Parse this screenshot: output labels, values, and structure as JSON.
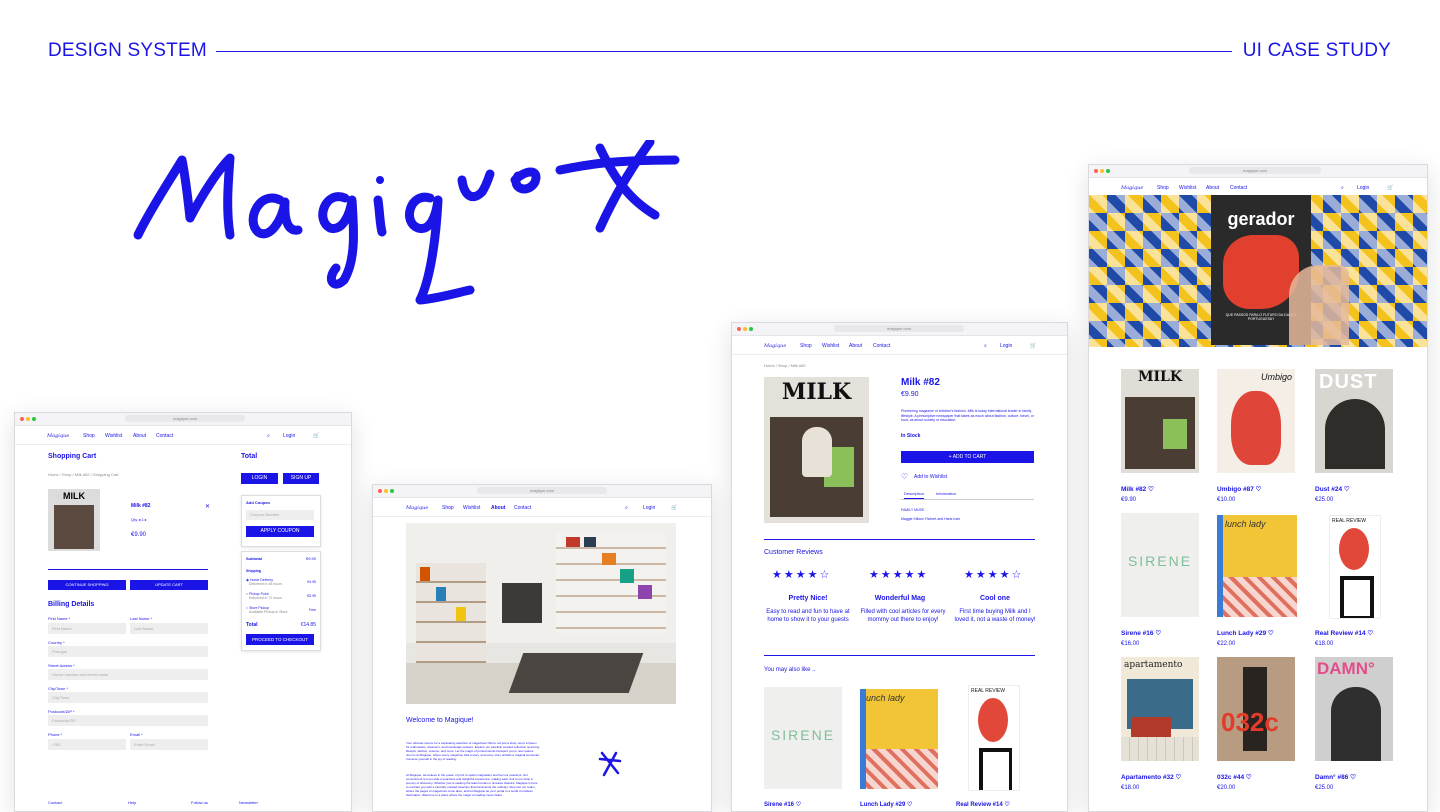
{
  "header": {
    "left": "DESIGN SYSTEM",
    "right": "UI CASE STUDY"
  },
  "brand": {
    "logo_text": "Magique"
  },
  "colors": {
    "accent": "#1a14e6"
  },
  "browser": {
    "url": "magique.com"
  },
  "nav": {
    "shop": "Shop",
    "wishlist": "Wishlist",
    "about": "About",
    "contact": "Contact",
    "login": "Login"
  },
  "cart": {
    "title": "Shopping Cart",
    "breadcrumb": "Home / Shop / Milk #82 / Shopping Cart",
    "item_title": "Milk #82",
    "qty": "Qty ◂ 1 ▸",
    "price": "€9.90",
    "remove": "✕",
    "continue": "CONTINUE SHOPPING",
    "update": "UPDATE CART",
    "total_title": "Total",
    "login_btn": "LOGIN",
    "signup_btn": "SIGN UP",
    "coupon_label": "Add Coupon",
    "coupon_placeholder": "Coupon Number",
    "apply": "APPLY COUPON",
    "subtotal_label": "Subtotal",
    "subtotal_value": "€9.90",
    "shipping_label": "Shipping",
    "ship_options": [
      {
        "name": "Home Delivery",
        "note": "Delivered in 48 hours",
        "price": "€4.95"
      },
      {
        "name": "Pickup Point",
        "note": "Delivered in 72 hours",
        "price": "€3.95"
      },
      {
        "name": "Store Pickup",
        "note": "Available Pickup in Store",
        "price": "Free"
      }
    ],
    "total_label": "Total",
    "total_value": "€14.85",
    "checkout": "PROCEED TO CHECKOUT",
    "billing_title": "Billing Details",
    "billing": {
      "first_label": "First Name *",
      "first_ph": "First Name",
      "last_label": "Last Name *",
      "last_ph": "Last Name",
      "country_label": "Country *",
      "country_val": "Portugal",
      "street_label": "Street Adress *",
      "street_ph": "House number and street name",
      "city_label": "City/Town *",
      "city_ph": "City/Town",
      "postcode_label": "Postcode/ZIP *",
      "postcode_ph": "Postcode/ZIP",
      "phone_label": "Phone *",
      "phone_ph": "+351",
      "email_label": "Email *",
      "email_ph": "Enter Email"
    },
    "footer": {
      "contact": "Contact",
      "help": "Help",
      "follow": "Follow us",
      "newsletter": "Newsletter"
    }
  },
  "about": {
    "welcome": "Welcome to Magique!",
    "para1": "Your ultimate source for a captivating selection of magazines! We're not just a shop; we're a haven for enthusiasts, dreamers, and knowledge seekers. Explore our carefully curated collection spanning lifestyle, fashion, science, and more. Let the magic of printed words transport you to new realms. Join us at Magique, where every magazine tells a story, and every story unfolds a magical encounter. Immerse yourself in the joy of reading.",
    "para2": "At Magique, we believe in the power of print to spark imagination and fuel our passions. Our commitment is to provide a seamless and delightful experience, making each visit to our shop a journey of discovery. Whether you're seeking the latest trends or timeless classics, Magique is here to enchant you with a carefully curated selection that transcends the ordinary. Step into our realm, where the pages of magazines come alive, and let Magique be your portal to a world of endless fascination. Welcome to a place where the magic of reading never fades."
  },
  "product": {
    "breadcrumb": "Home / Shop / Milk #82",
    "title": "Milk #82",
    "price": "€9.90",
    "desc": "Pioneering magazine of children's fashion. Milk is today international leader in family lifestyle. A prescriptive newspaper that takes as much about fashion, culture, travel, or food, as about society or education.",
    "stock": "In Stock",
    "add_to_cart": "+ ADD TO CART",
    "wishlist": "Add to Wishlist",
    "tab_desc": "Description",
    "tab_info": "Information",
    "desc_title": "FAMILY MUSE",
    "desc_body": "Maggie Kilburn Richert and Hans Irani",
    "reviews_title": "Customer Reviews",
    "reviews": [
      {
        "stars": "★★★★☆",
        "title": "Pretty Nice!",
        "body": "Easy to read and fun to have at home to show it to your guests"
      },
      {
        "stars": "★★★★★",
        "title": "Wonderful Mag",
        "body": "Filled with cool articles for every mommy out there to enjoy!"
      },
      {
        "stars": "★★★★☆",
        "title": "Cool one",
        "body": "First time buying Milk and I loved it, not a waste of money!"
      }
    ],
    "like_title": "You may also like ..",
    "like": [
      {
        "name": "Sirene #16 ♡"
      },
      {
        "name": "Lunch Lady #29 ♡"
      },
      {
        "name": "Real Review #14 ♡"
      }
    ]
  },
  "shop": {
    "hero_mag": "gerador",
    "hero_tagline": "QUE PASSOS PARA O FUTURO DA DANÇA PORTUGUESA?",
    "products": [
      {
        "name": "Milk #82 ♡",
        "price": "€9.90"
      },
      {
        "name": "Umbigo #87 ♡",
        "price": "€10.00"
      },
      {
        "name": "Dust #24 ♡",
        "price": "€25.00"
      },
      {
        "name": "Sirene #16 ♡",
        "price": "€16.00"
      },
      {
        "name": "Lunch Lady #29 ♡",
        "price": "€22.00"
      },
      {
        "name": "Real Review #14 ♡",
        "price": "€18.00"
      },
      {
        "name": "Apartamento #32 ♡",
        "price": "€18.00"
      },
      {
        "name": "032c #44 ♡",
        "price": "€20.00"
      },
      {
        "name": "Damn° #86 ♡",
        "price": "€25.00"
      }
    ],
    "covers": {
      "milk": "MILK",
      "umbigo": "Umbigo",
      "dust": "DUST",
      "sirene": "SIRENE",
      "lunch": "lunch lady",
      "real": "REAL REVIEW",
      "apart": "apartamento",
      "c032": "032c",
      "damn": "DAMN°"
    }
  }
}
